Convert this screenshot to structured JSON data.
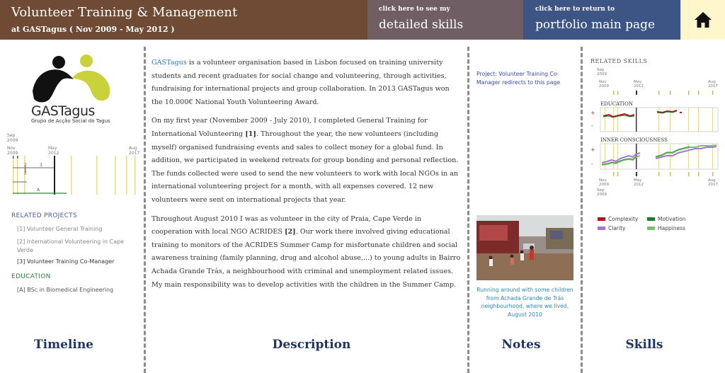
{
  "header": {
    "title": "Volunteer Training & Management",
    "subtitle": "at GASTagus ( Nov 2009 - May 2012 )",
    "skills_link": {
      "small": "click here to see my",
      "big": "detailed skills"
    },
    "portfolio_link": {
      "small": "click here to return to",
      "big": "portfolio main page"
    },
    "home_icon": "home-icon"
  },
  "timeline": {
    "logo_text": "GASTagus",
    "logo_sub": "Grupo de Acção Social do Tagus",
    "labels": {
      "sep_2009": [
        "Sep",
        "2009"
      ],
      "nov_2009": [
        "Nov",
        "2009"
      ],
      "may_2012": [
        "May",
        "2012"
      ],
      "aug_2017": [
        "Aug",
        "2017"
      ]
    },
    "markers": [
      "2",
      "1",
      "3",
      "A"
    ],
    "related_projects_heading": "RELATED PROJECTS",
    "related_projects": [
      "[1] Volunteer General Training",
      "[2] International Volunteering in Cape Verde",
      "[3] Volunteer Training Co-Manager"
    ],
    "education_heading": "EDUCATION",
    "education": [
      "[A] BSc in Biomedical Engineering"
    ],
    "footer": "Timeline"
  },
  "description": {
    "link_text": "GASTagus",
    "p1_rest": " is a volunteer organisation based in Lisbon focused on training university students and recent graduates for social change and volunteering, through activities, fundraising for international projects and group collaboration. In 2013 GASTagus won the 10.000€ National Youth Volunteering Award.",
    "p2_a": "On my first year (November 2009 - July 2010), I completed General Training for International Volunteering ",
    "p2_ref": "[1]",
    "p2_b": ". Throughout the year, the new volunteers (including myself) organised fundraising events and sales to collect money for a global fund. In addition, we participated in weekend retreats for group bonding and personal reflection. The funds collected were used to send the new volunteers to work with local NGOs in an international volunteering project for a month, with all expenses covered. 12 new volunteers were sent on international projects that year.",
    "p3_a": "Throughout August 2010 I was as volunteer in the city of Praia, Cape Verde in cooperation with local NGO ACRIDES ",
    "p3_ref": "[2]",
    "p3_b": ". Our work there involved giving educational training to monitors of the ACRIDES Summer Camp for misfortunate children and social awareness training (family planning, drug and alcohol abuse,...) to young adults in Bairro Achada Grande Trás, a neighbourhood with criminal and unemployment related issues. My main responsibility was to develop activities with the children in the Summer Camp.",
    "footer": "Description"
  },
  "notes": {
    "project_note": "Project: Volunteer Training Co-Manager redirects to this page",
    "photo_caption": "Running around with some children from Achada Grande de Trás neighbourhood, where we lived, August 2010",
    "footer": "Notes"
  },
  "skills": {
    "heading": "RELATED SKILLS",
    "labels": {
      "sep_2009": [
        "Sep",
        "2009"
      ],
      "nov_2009": [
        "Nov",
        "2009"
      ],
      "may_2012": [
        "May",
        "2012"
      ],
      "aug_2017": [
        "Aug",
        "2017"
      ]
    },
    "education_label": "EDUCATION",
    "inner_label": "INNER CONSCIOUSNESS",
    "plus": "+",
    "minus": "-",
    "legend": [
      {
        "name": "Complexity",
        "color": "#b0121e"
      },
      {
        "name": "Motivation",
        "color": "#1f7a33"
      },
      {
        "name": "Clarity",
        "color": "#a17ad0"
      },
      {
        "name": "Happiness",
        "color": "#7ac070"
      }
    ],
    "footer": "Skills"
  },
  "colors": {
    "header_brown": "#6f4a34",
    "header_mauve": "#6f5f64",
    "header_blue": "#3c5585",
    "header_cream": "#fff6cc",
    "footer_navy": "#1f3566"
  }
}
